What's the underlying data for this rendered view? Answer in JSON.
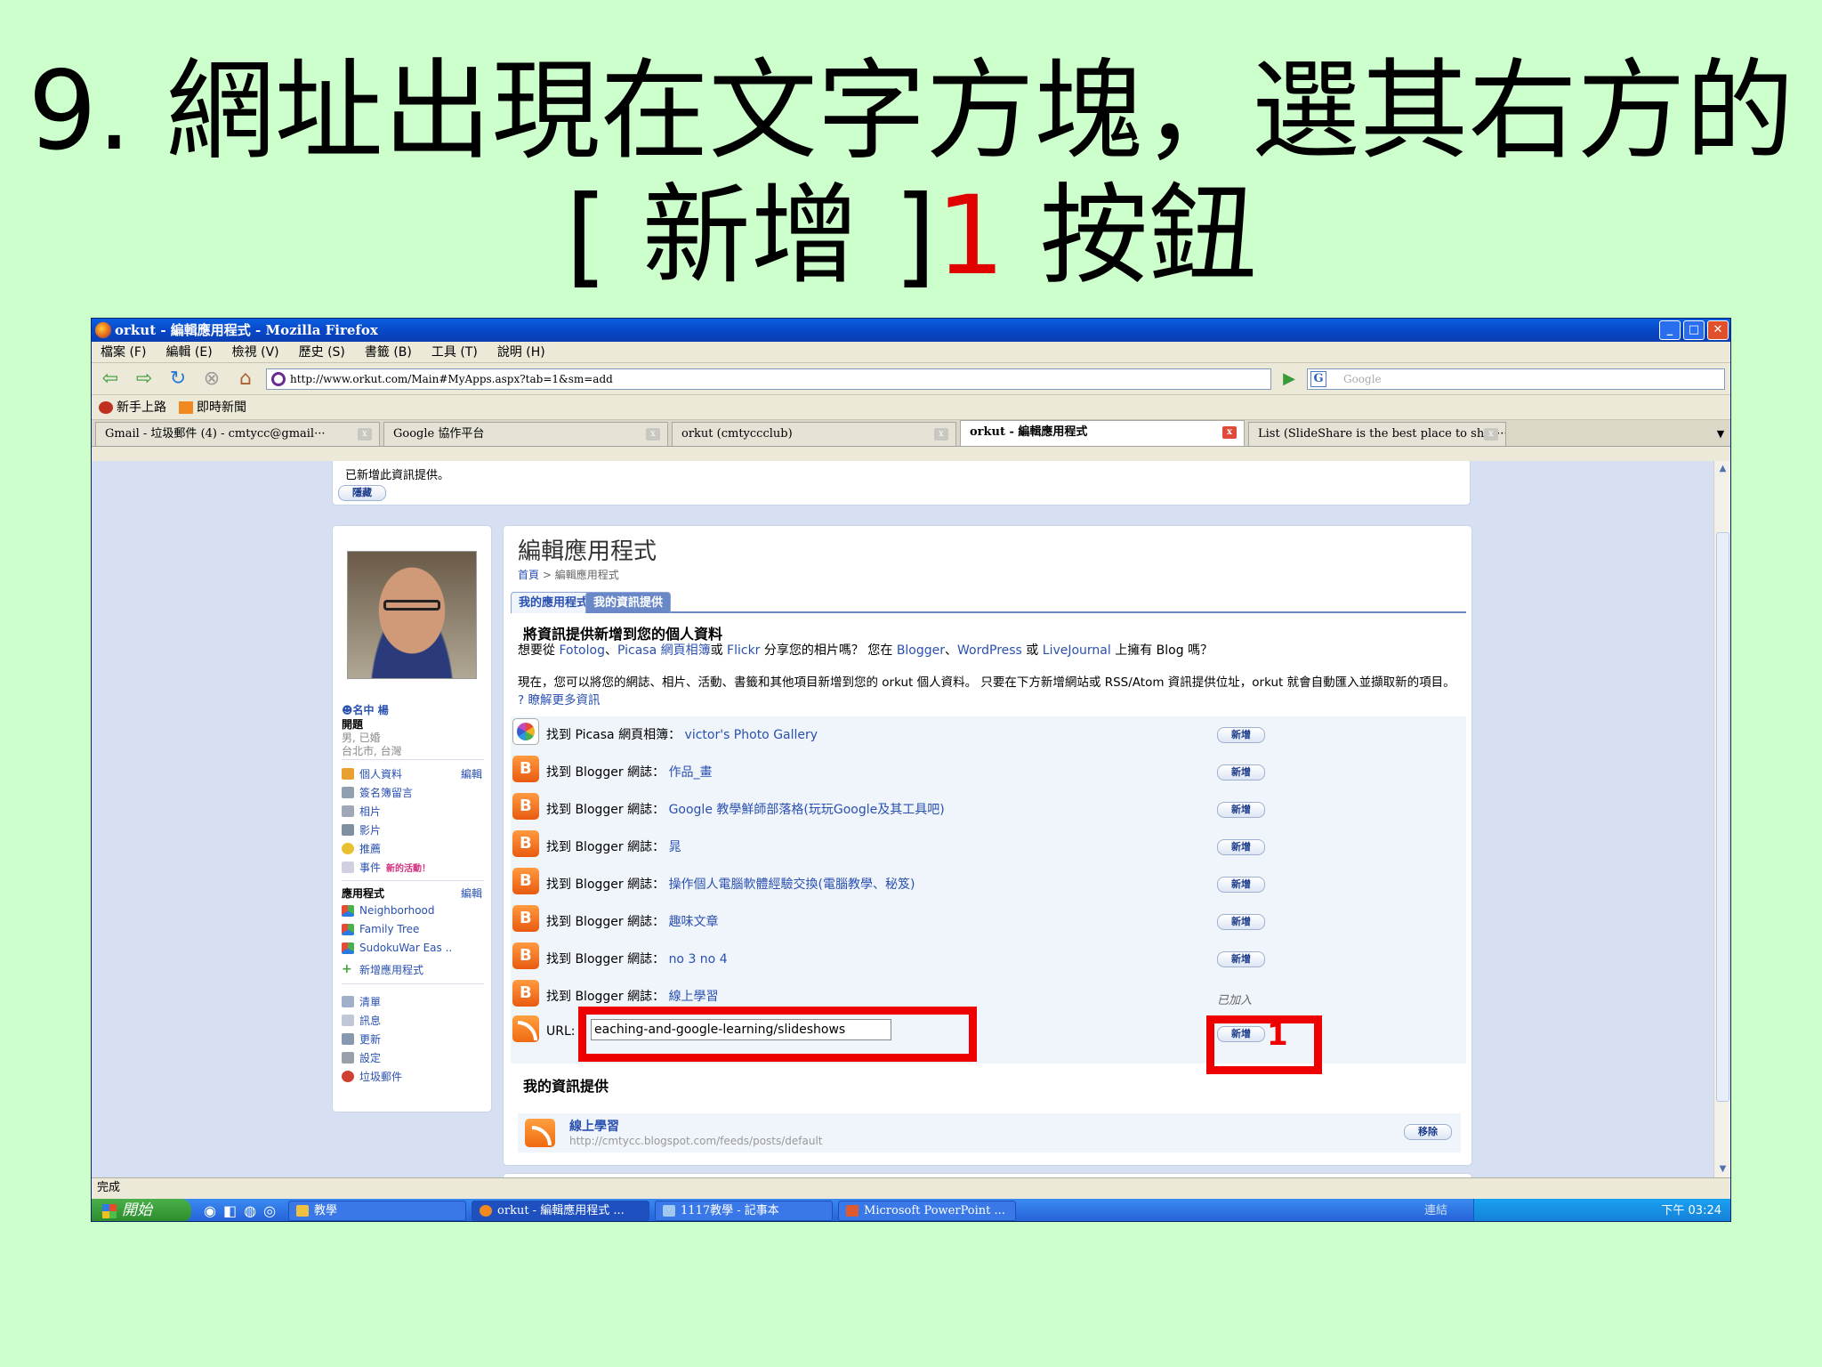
{
  "slide": {
    "title_line1": "9. 網址出現在文字方塊，選其右方的",
    "title_line2_a": "[ 新增 ]",
    "title_line2_num": "1",
    "title_line2_b": " 按鈕"
  },
  "window": {
    "title": "orkut - 編輯應用程式 - Mozilla Firefox",
    "controls": {
      "minimize": "_",
      "maximize": "□",
      "close": "✕"
    }
  },
  "menu": [
    "檔案 (F)",
    "編輯 (E)",
    "檢視 (V)",
    "歷史 (S)",
    "書籤 (B)",
    "工具 (T)",
    "說明 (H)"
  ],
  "nav": {
    "url": "http://www.orkut.com/Main#MyApps.aspx?tab=1&sm=add",
    "search_placeholder": "Google",
    "search_engine_glyph": "G"
  },
  "bookmarks": [
    "新手上路",
    "即時新聞"
  ],
  "tabs": [
    {
      "label": "Gmail - 垃圾郵件 (4) - cmtycc@gmail···"
    },
    {
      "label": "Google 協作平台"
    },
    {
      "label": "orkut (cmtyccclub)"
    },
    {
      "label": "orkut - 編輯應用程式"
    },
    {
      "label": "List (SlideShare is the best place to shar···"
    }
  ],
  "tab_close": "x",
  "notice": {
    "text": "已新增此資訊提供。",
    "hide_button": "隱藏"
  },
  "profile": {
    "name": "☻名中 楊",
    "status": "開題",
    "detail1": "男, 已婚",
    "detail2": "台北市, 台灣",
    "links": [
      "個人資料",
      "簽名簿留言",
      "相片",
      "影片",
      "推薦",
      "事件"
    ],
    "edit": "編輯",
    "event_badge": "新的活動！",
    "apps_header": "應用程式",
    "apps_edit": "編輯",
    "apps": [
      "Neighborhood",
      "Family Tree",
      "SudokuWar Eas ..",
      "新增應用程式"
    ],
    "bottom_links": [
      "清單",
      "訊息",
      "更新",
      "設定",
      "垃圾郵件"
    ]
  },
  "main": {
    "heading": "編輯應用程式",
    "crumb_home": "首頁",
    "crumb_sep": ">",
    "crumb_current": "編輯應用程式",
    "tab_apps": "我的應用程式",
    "tab_feeds": "我的資訊提供",
    "section_title": "將資訊提供新增到您的個人資料",
    "para1_a": "想要從 ",
    "para1_fotolog": "Fotolog",
    "para1_sep1": "、",
    "para1_picasa": "Picasa 網頁相簿",
    "para1_or1": "或 ",
    "para1_flickr": "Flickr",
    "para1_b": " 分享您的相片嗎？ 您在 ",
    "para1_blogger": "Blogger",
    "para1_sep2": "、",
    "para1_wordpress": "WordPress",
    "para1_or2": " 或 ",
    "para1_livejournal": "LiveJournal",
    "para1_c": " 上擁有 Blog 嗎？",
    "para2_a": "現在，您可以將您的網誌、相片、活動、書籤和其他項目新增到您的 orkut 個人資料。 只要在下方新增網站或 RSS/Atom 資訊提供位址，orkut 就會自動匯入並擷取新的項目。",
    "para2_more_icon": "?",
    "para2_more": "瞭解更多資訊",
    "feeds": [
      {
        "prefix": "找到 Picasa 網頁相簿：",
        "name": "victor's Photo Gallery",
        "action": "新增"
      },
      {
        "prefix": "找到 Blogger 網誌：",
        "name": "作品_畫",
        "action": "新增"
      },
      {
        "prefix": "找到 Blogger 網誌：",
        "name": "Google 教學鮮師部落格(玩玩Google及其工具吧)",
        "action": "新增"
      },
      {
        "prefix": "找到 Blogger 網誌：",
        "name": "晁",
        "action": "新增"
      },
      {
        "prefix": "找到 Blogger 網誌：",
        "name": "操作個人電腦軟體經驗交換(電腦教學、秘笈)",
        "action": "新增"
      },
      {
        "prefix": "找到 Blogger 網誌：",
        "name": "趣味文章",
        "action": "新增"
      },
      {
        "prefix": "找到 Blogger 網誌：",
        "name": "no 3 no 4",
        "action": "新增"
      },
      {
        "prefix": "找到 Blogger 網誌：",
        "name": "線上學習",
        "action": "已加入"
      }
    ],
    "url_label": "URL:",
    "url_value": "eaching-and-google-learning/slideshows",
    "url_add": "新增",
    "callout_num": "1",
    "my_feeds_title": "我的資訊提供",
    "my_feed_name": "線上學習",
    "my_feed_url": "http://cmtycc.blogspot.com/feeds/posts/default",
    "remove": "移除"
  },
  "status": "完成",
  "taskbar": {
    "start": "開始",
    "items": [
      "教學",
      "orkut - 編輯應用程式 ...",
      "1117教學 - 記事本",
      "Microsoft PowerPoint ..."
    ],
    "links": "連結",
    "clock": "下午 03:24"
  },
  "colors": {
    "bg": "#ccffcc",
    "highlight": "#ee0000",
    "link": "#2a50b0"
  }
}
